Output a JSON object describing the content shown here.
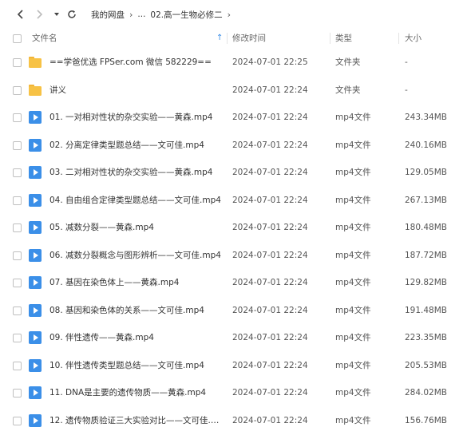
{
  "nav": {
    "back_icon": "chevron-left-icon",
    "forward_icon": "chevron-right-icon",
    "dropdown_icon": "caret-down-icon",
    "refresh_icon": "refresh-icon",
    "breadcrumb": [
      "我的网盘",
      "...",
      "02.高一生物必修二"
    ]
  },
  "columns": {
    "name": "文件名",
    "modified": "修改时间",
    "type": "类型",
    "size": "大小"
  },
  "files": [
    {
      "kind": "folder",
      "name": "==学爸优选 FPSer.com 微信 582229==",
      "modified": "2024-07-01 22:25",
      "type": "文件夹",
      "size": "-"
    },
    {
      "kind": "folder",
      "name": "讲义",
      "modified": "2024-07-01 22:24",
      "type": "文件夹",
      "size": "-"
    },
    {
      "kind": "video",
      "name": "01. 一对相对性状的杂交实验——黄森.mp4",
      "modified": "2024-07-01 22:24",
      "type": "mp4文件",
      "size": "243.34MB"
    },
    {
      "kind": "video",
      "name": "02. 分离定律类型题总结——文可佳.mp4",
      "modified": "2024-07-01 22:24",
      "type": "mp4文件",
      "size": "240.16MB"
    },
    {
      "kind": "video",
      "name": "03. 二对相对性状的杂交实验——黄森.mp4",
      "modified": "2024-07-01 22:24",
      "type": "mp4文件",
      "size": "129.05MB"
    },
    {
      "kind": "video",
      "name": "04. 自由组合定律类型题总结——文可佳.mp4",
      "modified": "2024-07-01 22:24",
      "type": "mp4文件",
      "size": "267.13MB"
    },
    {
      "kind": "video",
      "name": "05. 减数分裂——黄森.mp4",
      "modified": "2024-07-01 22:24",
      "type": "mp4文件",
      "size": "180.48MB"
    },
    {
      "kind": "video",
      "name": "06. 减数分裂概念与图形辨析——文可佳.mp4",
      "modified": "2024-07-01 22:24",
      "type": "mp4文件",
      "size": "187.72MB"
    },
    {
      "kind": "video",
      "name": "07. 基因在染色体上——黄森.mp4",
      "modified": "2024-07-01 22:24",
      "type": "mp4文件",
      "size": "129.82MB"
    },
    {
      "kind": "video",
      "name": "08. 基因和染色体的关系——文可佳.mp4",
      "modified": "2024-07-01 22:24",
      "type": "mp4文件",
      "size": "191.48MB"
    },
    {
      "kind": "video",
      "name": "09. 伴性遗传——黄森.mp4",
      "modified": "2024-07-01 22:24",
      "type": "mp4文件",
      "size": "223.35MB"
    },
    {
      "kind": "video",
      "name": "10. 伴性遗传类型题总结——文可佳.mp4",
      "modified": "2024-07-01 22:24",
      "type": "mp4文件",
      "size": "205.53MB"
    },
    {
      "kind": "video",
      "name": "11. DNA是主要的遗传物质——黄森.mp4",
      "modified": "2024-07-01 22:24",
      "type": "mp4文件",
      "size": "284.02MB"
    },
    {
      "kind": "video",
      "name": "12. 遗传物质验证三大实验对比——文可佳.m...",
      "modified": "2024-07-01 22:24",
      "type": "mp4文件",
      "size": "156.76MB"
    }
  ]
}
